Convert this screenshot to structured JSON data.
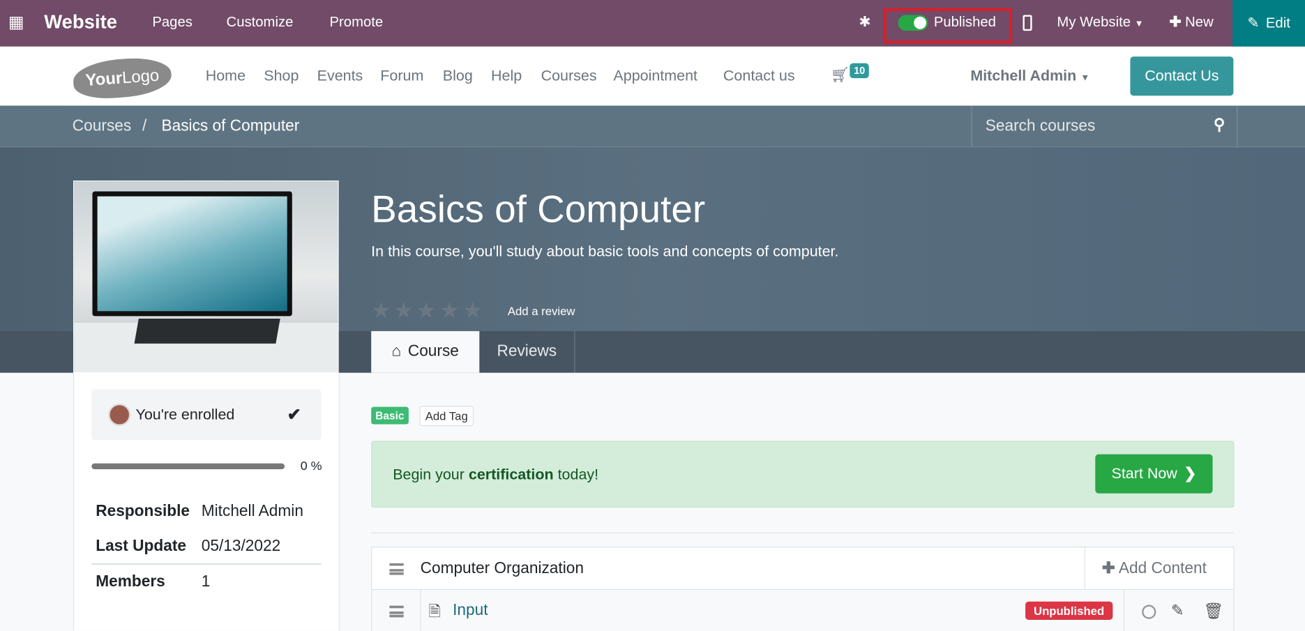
{
  "topbar": {
    "app": "Website",
    "menu": [
      "Pages",
      "Customize",
      "Promote"
    ],
    "published_label": "Published",
    "published": true,
    "website": "My Website",
    "new": "New",
    "edit": "Edit",
    "colors": {
      "bar": "#714b67",
      "edit": "#017e84",
      "highlight": "#e31b23"
    }
  },
  "nav": {
    "logo": "YourLogo",
    "items": [
      "Home",
      "Shop",
      "Events",
      "Forum",
      "Blog",
      "Help",
      "Courses",
      "Appointment",
      "Contact us"
    ],
    "cart_count": "10",
    "user": "Mitchell Admin",
    "contact_button": "Contact Us"
  },
  "breadcrumb": {
    "parent": "Courses",
    "sep": "/",
    "current": "Basics of Computer"
  },
  "search": {
    "placeholder": "Search courses"
  },
  "course": {
    "title": "Basics of Computer",
    "description": "In this course, you'll study about basic tools and concepts of computer.",
    "rating": 0,
    "add_review": "Add a review",
    "tabs": [
      "Course",
      "Reviews"
    ]
  },
  "sidebar": {
    "enrolled": "You're enrolled",
    "progress_pct": 0,
    "progress_label": "0 %",
    "fields": [
      {
        "label": "Responsible",
        "value": "Mitchell Admin"
      },
      {
        "label": "Last Update",
        "value": "05/13/2022"
      },
      {
        "label": "Members",
        "value": "1"
      }
    ]
  },
  "tags": {
    "tag": "Basic",
    "add": "Add Tag"
  },
  "alert": {
    "pre": "Begin your ",
    "bold": "certification",
    "post": " today!",
    "button": "Start Now"
  },
  "content": {
    "section": "Computer Organization",
    "add_content": "Add Content",
    "items": [
      {
        "title": "Input",
        "status": "Unpublished"
      }
    ]
  }
}
